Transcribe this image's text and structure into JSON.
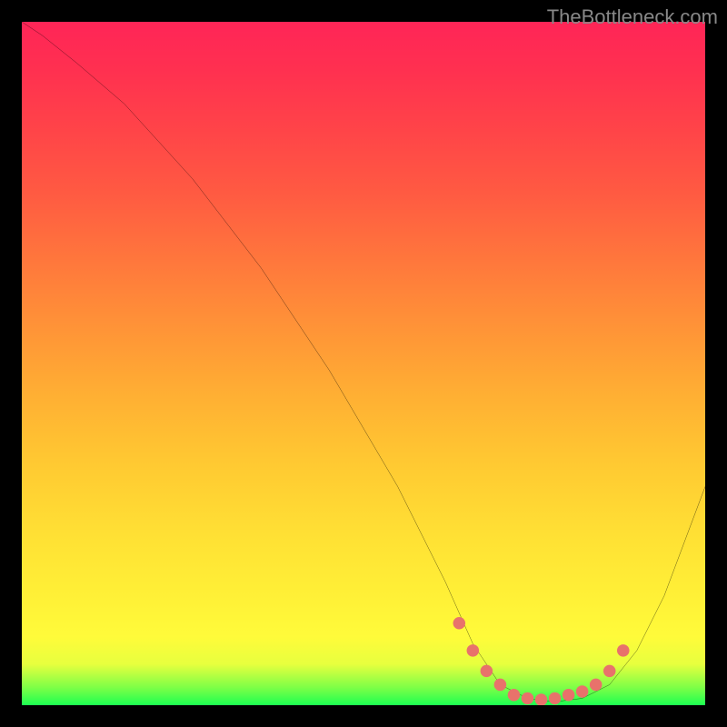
{
  "watermark": "TheBottleneck.com",
  "chart_data": {
    "type": "line",
    "title": "",
    "xlabel": "",
    "ylabel": "",
    "xlim": [
      0,
      100
    ],
    "ylim": [
      0,
      100
    ],
    "gradient_stops": [
      {
        "pos": 0,
        "color": "#1dff51"
      },
      {
        "pos": 2.5,
        "color": "#7bff47"
      },
      {
        "pos": 6,
        "color": "#e7ff3e"
      },
      {
        "pos": 10,
        "color": "#fffb3a"
      },
      {
        "pos": 15,
        "color": "#fff237"
      },
      {
        "pos": 25,
        "color": "#ffe034"
      },
      {
        "pos": 35,
        "color": "#ffca32"
      },
      {
        "pos": 45,
        "color": "#ffb033"
      },
      {
        "pos": 55,
        "color": "#ff9437"
      },
      {
        "pos": 65,
        "color": "#ff773c"
      },
      {
        "pos": 75,
        "color": "#ff5a42"
      },
      {
        "pos": 85,
        "color": "#ff4249"
      },
      {
        "pos": 93,
        "color": "#ff3050"
      },
      {
        "pos": 100,
        "color": "#ff2557"
      }
    ],
    "series": [
      {
        "name": "bottleneck-curve",
        "x": [
          0,
          3,
          8,
          15,
          25,
          35,
          45,
          55,
          62,
          66,
          70,
          74,
          78,
          82,
          86,
          90,
          94,
          100
        ],
        "y": [
          100,
          98,
          94,
          88,
          77,
          64,
          49,
          32,
          18,
          9,
          3,
          1,
          0.5,
          1,
          3,
          8,
          16,
          32
        ]
      }
    ],
    "markers": {
      "name": "optimal-range",
      "color": "#e8726b",
      "x": [
        64,
        66,
        68,
        70,
        72,
        74,
        76,
        78,
        80,
        82,
        84,
        86,
        88
      ],
      "y": [
        12,
        8,
        5,
        3,
        1.5,
        1,
        0.8,
        1,
        1.5,
        2,
        3,
        5,
        8
      ]
    }
  }
}
